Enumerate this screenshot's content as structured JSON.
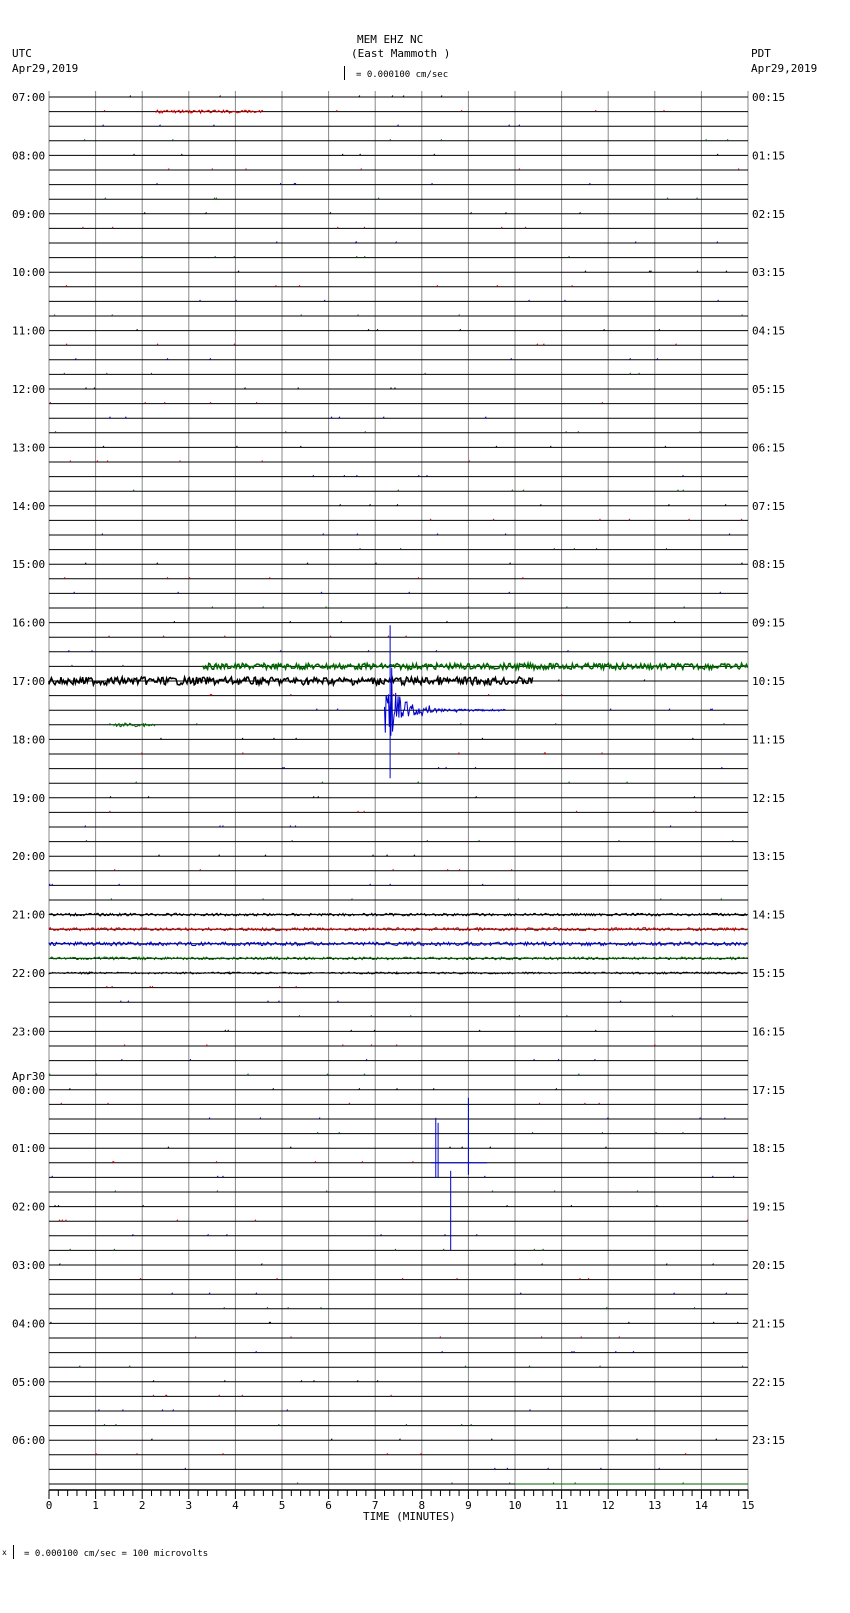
{
  "header": {
    "station": "MEM EHZ NC",
    "location": "(East Mammoth )",
    "left_tz": "UTC",
    "left_date": "Apr29,2019",
    "right_tz": "PDT",
    "right_date": "Apr29,2019",
    "scale": "= 0.000100 cm/sec"
  },
  "footer": {
    "scale": "= 0.000100 cm/sec =     100 microvolts",
    "mark": "x"
  },
  "chart_data": {
    "type": "line",
    "title": "MEM EHZ NC (East Mammoth )",
    "xlabel": "TIME (MINUTES)",
    "xlim": [
      0,
      15
    ],
    "x_ticks": [
      "0",
      "1",
      "2",
      "3",
      "4",
      "5",
      "6",
      "7",
      "8",
      "9",
      "10",
      "11",
      "12",
      "13",
      "14",
      "15"
    ],
    "left_labels": [
      "07:00",
      "08:00",
      "09:00",
      "10:00",
      "11:00",
      "12:00",
      "13:00",
      "14:00",
      "15:00",
      "16:00",
      "17:00",
      "18:00",
      "19:00",
      "20:00",
      "21:00",
      "22:00",
      "23:00",
      "00:00",
      "01:00",
      "02:00",
      "03:00",
      "04:00",
      "05:00",
      "06:00"
    ],
    "date_change_label": "Apr30",
    "right_labels": [
      "00:15",
      "01:15",
      "02:15",
      "03:15",
      "04:15",
      "05:15",
      "06:15",
      "07:15",
      "08:15",
      "09:15",
      "10:15",
      "11:15",
      "12:15",
      "13:15",
      "14:15",
      "15:15",
      "16:15",
      "17:15",
      "18:15",
      "19:15",
      "20:15",
      "21:15",
      "22:15",
      "23:15"
    ],
    "trace_colors": [
      "#000000",
      "#cc0000",
      "#0000cc",
      "#006600"
    ],
    "traces_per_hour": 4,
    "events": [
      {
        "trace": 39,
        "start_min": 3.3,
        "end_min": 15,
        "kind": "noise",
        "amp": 3,
        "color": "#006600"
      },
      {
        "trace": 40,
        "start_min": 0,
        "end_min": 10.4,
        "kind": "noise",
        "amp": 4,
        "color": "#000000"
      },
      {
        "trace": 42,
        "start_min": 7.2,
        "end_min": 9.8,
        "kind": "quake",
        "amp": 70,
        "color": "#0000cc"
      },
      {
        "trace": 1,
        "start_min": 2.3,
        "end_min": 4.6,
        "kind": "noise",
        "amp": 1.5,
        "color": "#cc0000"
      },
      {
        "trace": 43,
        "start_min": 1.4,
        "end_min": 2.3,
        "kind": "noise",
        "amp": 2,
        "color": "#006600"
      },
      {
        "trace": 73,
        "start_min": 8.2,
        "end_min": 9.4,
        "kind": "spikes",
        "amp": 50,
        "color": "#0000cc"
      },
      {
        "trace": 56,
        "start_min": 0,
        "end_min": 15,
        "kind": "noise",
        "amp": 1.3,
        "color": "#000000"
      },
      {
        "trace": 57,
        "start_min": 0,
        "end_min": 15,
        "kind": "noise",
        "amp": 1.5,
        "color": "#cc0000"
      },
      {
        "trace": 58,
        "start_min": 0,
        "end_min": 15,
        "kind": "noise",
        "amp": 1.8,
        "color": "#0000cc"
      },
      {
        "trace": 59,
        "start_min": 0,
        "end_min": 15,
        "kind": "noise",
        "amp": 1.3,
        "color": "#006600"
      },
      {
        "trace": 60,
        "start_min": 0,
        "end_min": 15,
        "kind": "noise",
        "amp": 0.9,
        "color": "#000000"
      },
      {
        "trace": 95,
        "start_min": 10,
        "end_min": 15,
        "kind": "flat",
        "amp": 0,
        "color": "#006600"
      }
    ]
  }
}
